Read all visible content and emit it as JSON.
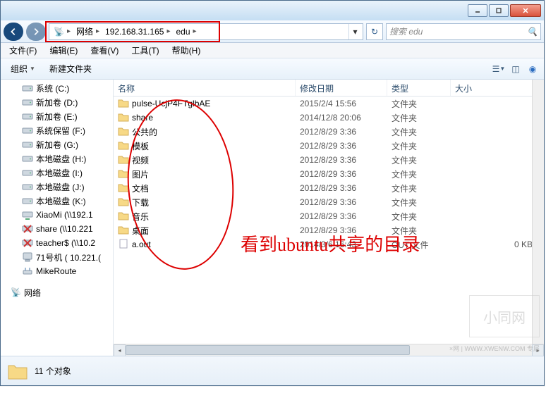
{
  "breadcrumb": {
    "root": "网络",
    "ip": "192.168.31.165",
    "folder": "edu"
  },
  "search": {
    "placeholder": "搜索 edu"
  },
  "menu": {
    "file": "文件(F)",
    "edit": "编辑(E)",
    "view": "查看(V)",
    "tools": "工具(T)",
    "help": "帮助(H)"
  },
  "toolbar": {
    "organize": "组织",
    "newfolder": "新建文件夹"
  },
  "columns": {
    "name": "名称",
    "date": "修改日期",
    "type": "类型",
    "size": "大小"
  },
  "sidebar": {
    "items": [
      {
        "label": "系统 (C:)",
        "icon": "drive"
      },
      {
        "label": "新加卷 (D:)",
        "icon": "drive"
      },
      {
        "label": "新加卷 (E:)",
        "icon": "drive"
      },
      {
        "label": "系统保留 (F:)",
        "icon": "drive"
      },
      {
        "label": "新加卷 (G:)",
        "icon": "drive"
      },
      {
        "label": "本地磁盘 (H:)",
        "icon": "drive"
      },
      {
        "label": "本地磁盘 (I:)",
        "icon": "drive"
      },
      {
        "label": "本地磁盘 (J:)",
        "icon": "drive"
      },
      {
        "label": "本地磁盘 (K:)",
        "icon": "drive"
      },
      {
        "label": "XiaoMi (\\\\192.1",
        "icon": "netdrive"
      },
      {
        "label": "share (\\\\10.221",
        "icon": "netdrive-x"
      },
      {
        "label": "teacher$ (\\\\10.2",
        "icon": "netdrive-x"
      },
      {
        "label": "71号机 ( 10.221.(",
        "icon": "computer"
      },
      {
        "label": "MikeRoute",
        "icon": "router"
      }
    ],
    "network": "网络"
  },
  "files": [
    {
      "name": "pulse-UcjP4FTglbAE",
      "date": "2015/2/4 15:56",
      "type": "文件夹",
      "size": "",
      "icon": "folder"
    },
    {
      "name": "share",
      "date": "2014/12/8 20:06",
      "type": "文件夹",
      "size": "",
      "icon": "folder"
    },
    {
      "name": "公共的",
      "date": "2012/8/29 3:36",
      "type": "文件夹",
      "size": "",
      "icon": "folder"
    },
    {
      "name": "模板",
      "date": "2012/8/29 3:36",
      "type": "文件夹",
      "size": "",
      "icon": "folder"
    },
    {
      "name": "视频",
      "date": "2012/8/29 3:36",
      "type": "文件夹",
      "size": "",
      "icon": "folder"
    },
    {
      "name": "图片",
      "date": "2012/8/29 3:36",
      "type": "文件夹",
      "size": "",
      "icon": "folder"
    },
    {
      "name": "文档",
      "date": "2012/8/29 3:36",
      "type": "文件夹",
      "size": "",
      "icon": "folder"
    },
    {
      "name": "下载",
      "date": "2012/8/29 3:36",
      "type": "文件夹",
      "size": "",
      "icon": "folder"
    },
    {
      "name": "音乐",
      "date": "2012/8/29 3:36",
      "type": "文件夹",
      "size": "",
      "icon": "folder"
    },
    {
      "name": "桌面",
      "date": "2012/8/29 3:36",
      "type": "文件夹",
      "size": "",
      "icon": "folder"
    },
    {
      "name": "a.out",
      "date": "2014/3/6 16:43",
      "type": "OUT 文件",
      "size": "0 KB",
      "icon": "file"
    }
  ],
  "status": {
    "count": "11 个对象"
  },
  "annotation": "看到ubuntu共享的目录",
  "watermark": {
    "logo": "小同网",
    "url": "×网 | WWW.XWENW.COM 专属"
  }
}
